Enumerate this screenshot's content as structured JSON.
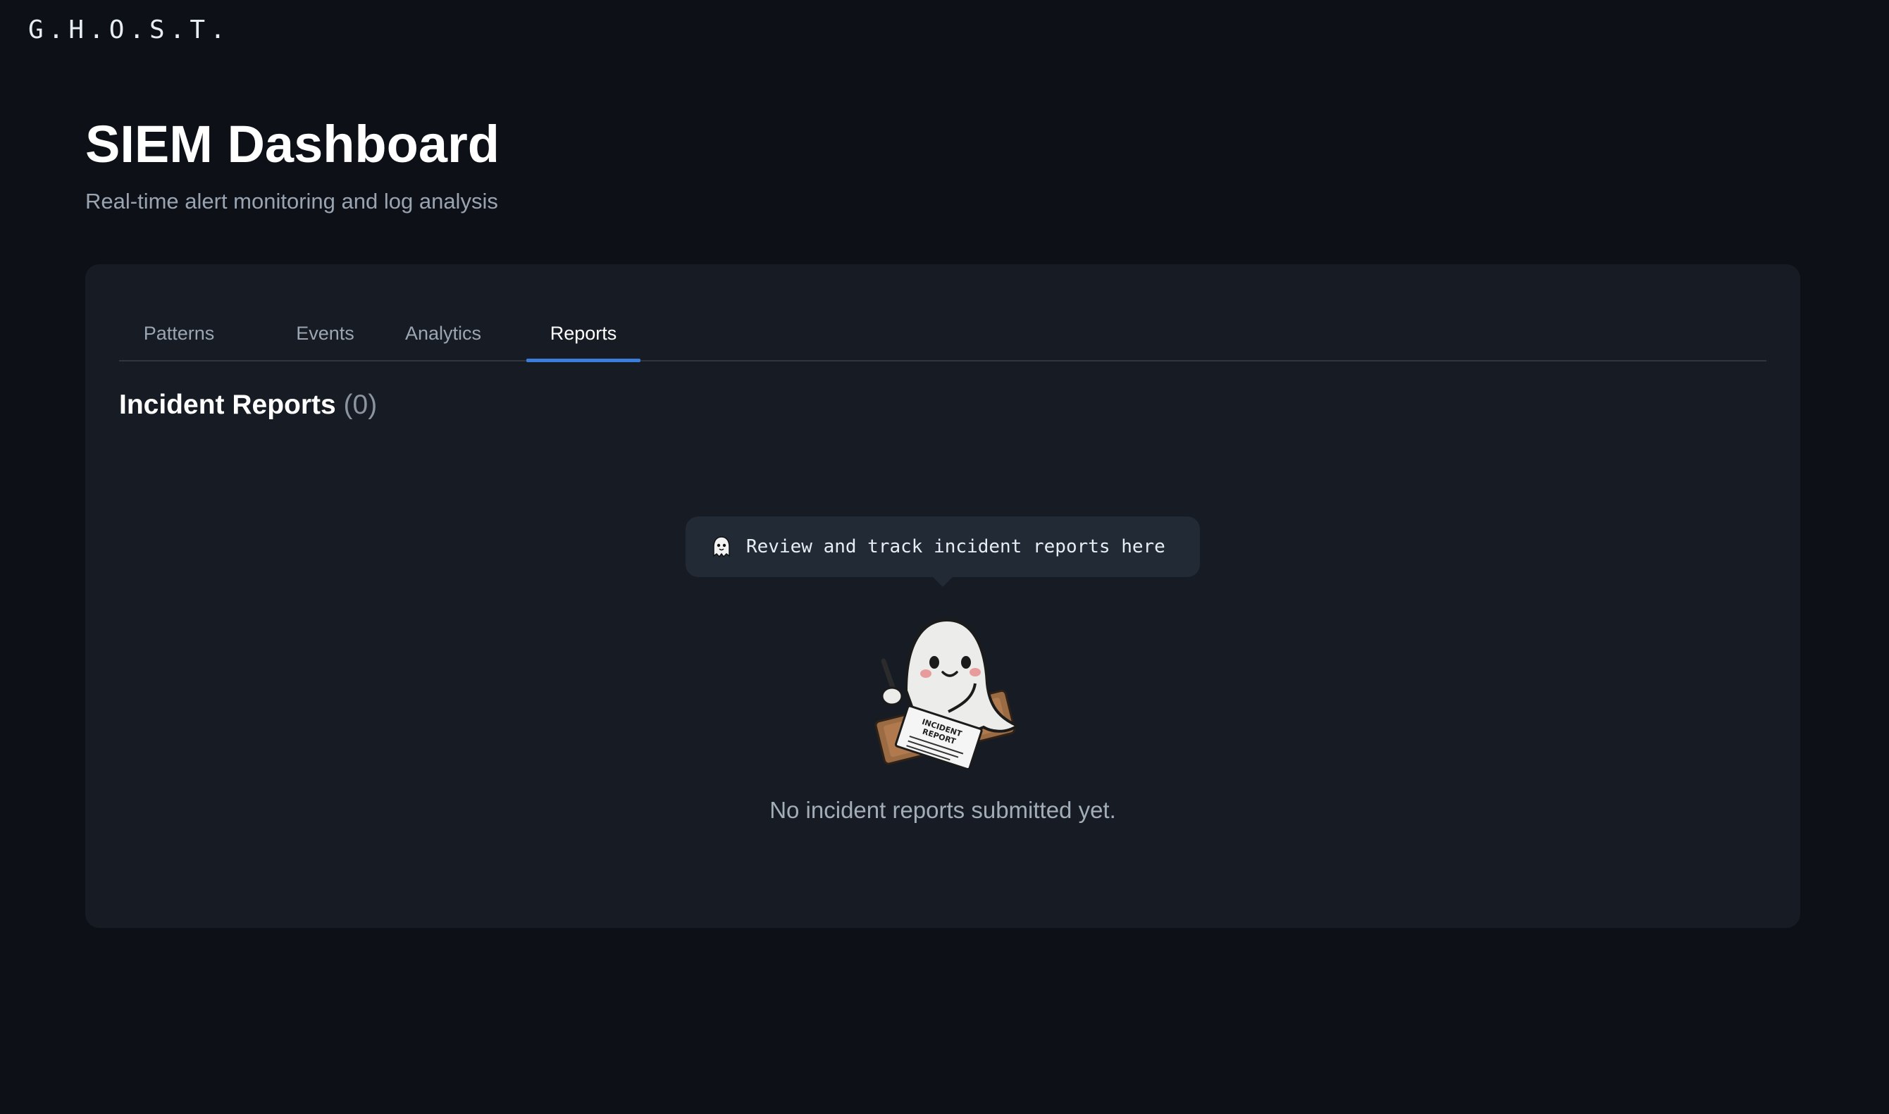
{
  "app": {
    "logo": "G.H.O.S.T."
  },
  "header": {
    "title": "SIEM Dashboard",
    "subtitle": "Real-time alert monitoring and log analysis"
  },
  "tabs": [
    {
      "label": "Patterns",
      "active": false
    },
    {
      "label": "Events",
      "active": false
    },
    {
      "label": "Analytics",
      "active": false
    },
    {
      "label": "Reports",
      "active": true
    }
  ],
  "reports": {
    "title": "Incident Reports",
    "count": "(0)",
    "tooltip": "Review and track incident reports here",
    "tooltip_icon": "ghost-icon",
    "empty_message": "No incident reports submitted yet.",
    "illustration_text_line1": "INCIDENT",
    "illustration_text_line2": "REPORT"
  },
  "colors": {
    "background": "#0d1017",
    "panel": "#161b24",
    "accent": "#3b7ddd",
    "tooltip_bg": "#222a36"
  }
}
